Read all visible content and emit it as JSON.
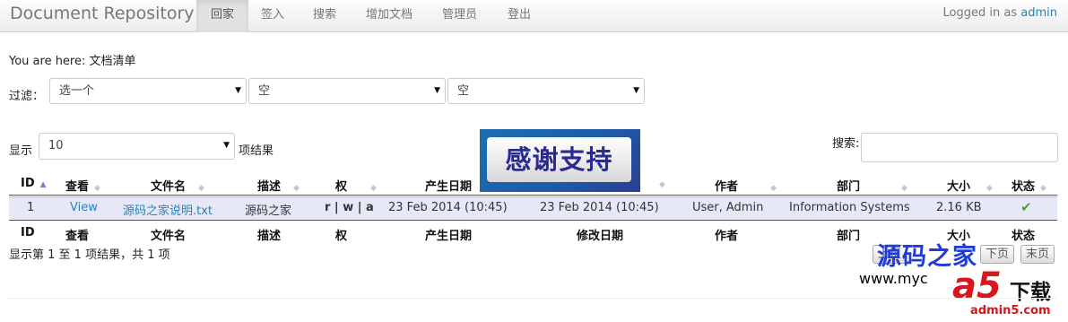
{
  "navbar": {
    "brand": "Document Repository",
    "items": [
      "回家",
      "签入",
      "搜索",
      "增加文档",
      "管理员",
      "登出"
    ],
    "login_prefix": "Logged in as",
    "user": "admin"
  },
  "breadcrumb": "You are here: 文档清单",
  "filter": {
    "label": "过滤：",
    "selects": [
      "选一个",
      "空",
      "空"
    ]
  },
  "length": {
    "show_label": "显示",
    "value": "10",
    "suffix": "项结果"
  },
  "search_label": "搜索:",
  "banner": "感谢支持",
  "table": {
    "headers": [
      "ID",
      "查看",
      "文件名",
      "描述",
      "权",
      "产生日期",
      "修改日期",
      "作者",
      "部门",
      "大小",
      "状态"
    ],
    "footers": [
      "ID",
      "查看",
      "文件名",
      "描述",
      "权",
      "产生日期",
      "修改日期",
      "作者",
      "部门",
      "大小",
      "状态"
    ],
    "row": {
      "id": "1",
      "view": "View",
      "filename": "源码之家说明.txt",
      "description": "源码之家",
      "rights": "r | w | a",
      "created": "23 Feb 2014 (10:45)",
      "modified": "23 Feb 2014 (10:45)",
      "author": "User, Admin",
      "department": "Information Systems",
      "size": "2.16 KB",
      "status_icon": "checkmark-icon"
    }
  },
  "info": "显示第 1 至 1 项结果，共 1 项",
  "pagination": [
    "上页",
    "下页",
    "末页"
  ],
  "watermark": {
    "title": "源码之家",
    "url_partial": "www.myc",
    "logo": "a5",
    "logo_text": "下载",
    "logo_url": "admin5.com"
  }
}
